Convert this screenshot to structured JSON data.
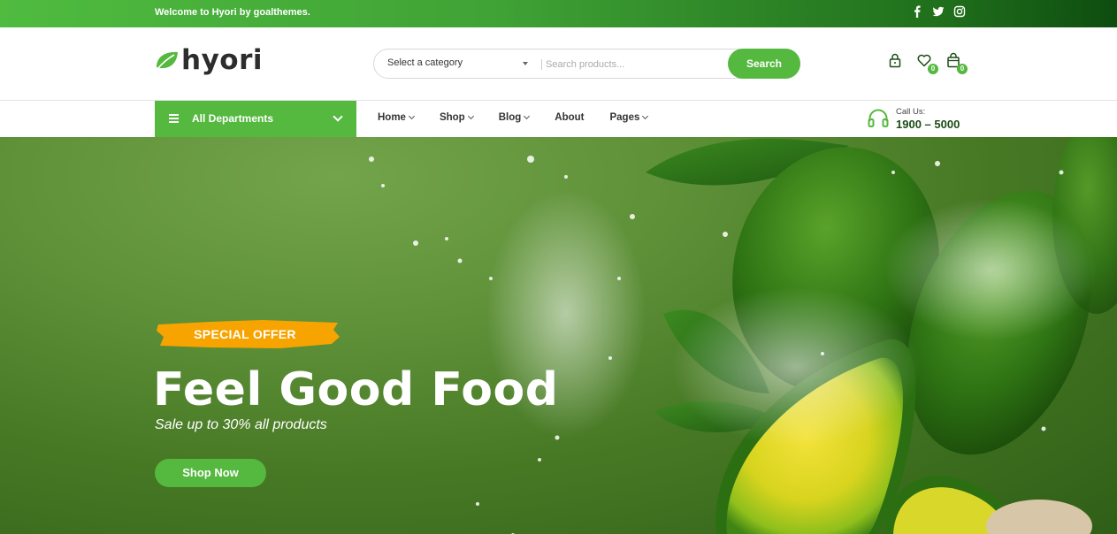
{
  "topbar": {
    "welcome": "Welcome to Hyori by goalthemes.",
    "social": [
      "facebook-icon",
      "twitter-icon",
      "instagram-icon"
    ]
  },
  "header": {
    "logo_text": "hyori",
    "search": {
      "category_label": "Select a category",
      "placeholder": "Search products...",
      "button": "Search"
    },
    "wishlist_count": "0",
    "cart_count": "0"
  },
  "nav": {
    "all_departments": "All Departments",
    "menu": [
      {
        "label": "Home",
        "dropdown": true
      },
      {
        "label": "Shop",
        "dropdown": true
      },
      {
        "label": "Blog",
        "dropdown": true
      },
      {
        "label": "About",
        "dropdown": false
      },
      {
        "label": "Pages",
        "dropdown": true
      }
    ],
    "call_label": "Call Us:",
    "call_number": "1900 – 5000"
  },
  "hero": {
    "badge": "SPECIAL OFFER",
    "title": "Feel Good Food",
    "subtitle": "Sale up to 30% all products",
    "button": "Shop Now"
  },
  "colors": {
    "brand_green": "#55b83f",
    "dark_green": "#1c4d16",
    "offer_orange": "#f7a400"
  }
}
